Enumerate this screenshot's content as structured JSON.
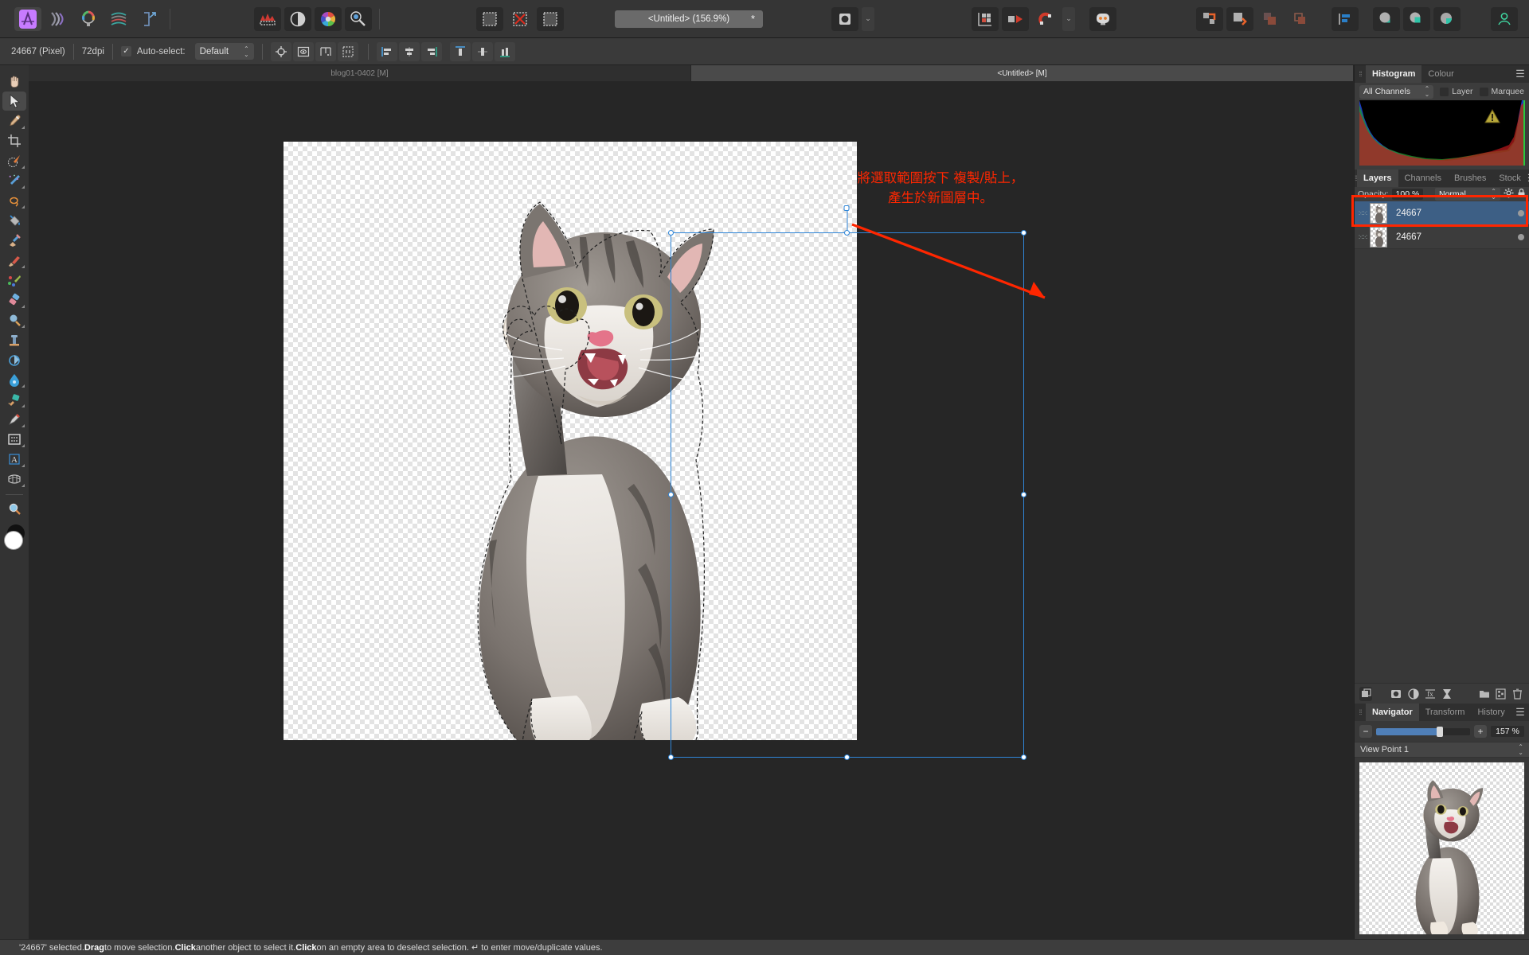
{
  "app": {
    "name": "Affinity Photo"
  },
  "toolbar": {
    "left_icons": [
      {
        "name": "app-persona-photo",
        "label": "Photo Persona"
      },
      {
        "name": "liquify-persona",
        "label": "Liquify Persona"
      },
      {
        "name": "develop-persona",
        "label": "Develop Persona"
      },
      {
        "name": "tone-mapping-persona",
        "label": "Tone Mapping Persona"
      },
      {
        "name": "export-persona",
        "label": "Export Persona"
      }
    ],
    "adjust_icons": [
      {
        "name": "histogram-adjust-icon",
        "label": "Adjustment"
      },
      {
        "name": "live-filter-icon",
        "label": "Live Filter"
      },
      {
        "name": "colour-wheel-icon",
        "label": "Colour"
      },
      {
        "name": "blemish-remove-icon",
        "label": "Blemish Removal"
      }
    ],
    "select_icons": [
      {
        "name": "select-pixel-icon",
        "label": "Select Pixel"
      },
      {
        "name": "deselect-icon",
        "label": "Deselect"
      },
      {
        "name": "refine-selection-icon",
        "label": "Refine Selection"
      }
    ],
    "document_title": "<Untitled> (156.9%)",
    "document_modified_mark": "*",
    "mask_icon_label": "Mask",
    "right_icons": [
      {
        "name": "snapping-grid-icon",
        "label": "Snapping Grid"
      },
      {
        "name": "snapping-candidates-icon",
        "label": "Snapping Candidates"
      },
      {
        "name": "magnet-snapping-icon",
        "label": "Snapping"
      },
      {
        "name": "assistant-icon",
        "label": "Assistant"
      },
      {
        "name": "arrange-move-icon",
        "label": "Arrange"
      },
      {
        "name": "arrange-forward-icon",
        "label": "Move Forward"
      },
      {
        "name": "arrange-back-icon",
        "label": "Move Back"
      },
      {
        "name": "arrange-backward-icon",
        "label": "Move Backward"
      },
      {
        "name": "studio-toggle-icon",
        "label": "Studio"
      },
      {
        "name": "boolean-add-icon",
        "label": "Add"
      },
      {
        "name": "boolean-subtract-icon",
        "label": "Subtract"
      },
      {
        "name": "boolean-intersect-icon",
        "label": "Intersect"
      },
      {
        "name": "account-icon",
        "label": "Account"
      }
    ]
  },
  "context_bar": {
    "doc_size": "24667 (Pixel)",
    "dpi": "72dpi",
    "autoselect_label": "Auto-select:",
    "autoselect_checked": true,
    "mode_value": "Default",
    "transform_buttons": [
      {
        "name": "show-transform-origin-icon",
        "label": "Transform origin"
      },
      {
        "name": "show-selection-bounds-icon",
        "label": "Show selection bounds"
      },
      {
        "name": "enable-transform-handles-icon",
        "label": "Transform handles"
      },
      {
        "name": "cycle-selection-box-icon",
        "label": "Cycle selection box"
      }
    ],
    "align_buttons": [
      {
        "name": "align-left-icon",
        "label": "Align left"
      },
      {
        "name": "align-center-horizontal-icon",
        "label": "Align centre"
      },
      {
        "name": "align-right-icon",
        "label": "Align right"
      },
      {
        "name": "align-top-icon",
        "label": "Align top"
      },
      {
        "name": "align-middle-vertical-icon",
        "label": "Align middle"
      },
      {
        "name": "align-bottom-icon",
        "label": "Align bottom"
      }
    ]
  },
  "tools": [
    {
      "name": "view-hand-tool",
      "label": "View Tool",
      "active": false,
      "glyph": "hand"
    },
    {
      "name": "move-tool",
      "label": "Move Tool",
      "active": true,
      "glyph": "cursor"
    },
    {
      "name": "colour-picker-tool",
      "label": "Colour Picker Tool",
      "active": false,
      "glyph": "picker"
    },
    {
      "name": "crop-tool",
      "label": "Crop Tool",
      "active": false,
      "glyph": "crop"
    },
    {
      "name": "selection-brush-tool",
      "label": "Selection Brush Tool",
      "active": false,
      "glyph": "selbrush"
    },
    {
      "name": "flood-select-tool",
      "label": "Flood Select Tool",
      "active": false,
      "glyph": "wand"
    },
    {
      "name": "freehand-selection-tool",
      "label": "Freehand Selection Tool",
      "active": false,
      "glyph": "lasso"
    },
    {
      "name": "paint-bucket-tool",
      "label": "Flood Fill Tool",
      "active": false,
      "glyph": "bucket"
    },
    {
      "name": "inpainting-brush-tool",
      "label": "Inpainting Brush Tool",
      "active": false,
      "glyph": "inpaint"
    },
    {
      "name": "paint-brush-tool",
      "label": "Paint Brush Tool",
      "active": false,
      "glyph": "brush"
    },
    {
      "name": "paint-mixer-brush-tool",
      "label": "Paint Mixer Brush Tool",
      "active": false,
      "glyph": "mixer"
    },
    {
      "name": "erase-brush-tool",
      "label": "Erase Brush Tool",
      "active": false,
      "glyph": "eraser"
    },
    {
      "name": "dodge-brush-tool",
      "label": "Dodge Brush Tool",
      "active": false,
      "glyph": "dodge"
    },
    {
      "name": "clone-brush-tool",
      "label": "Clone Brush Tool",
      "active": false,
      "glyph": "clone"
    },
    {
      "name": "smudge-brush-tool",
      "label": "Smudge Brush Tool",
      "active": false,
      "glyph": "smudge"
    },
    {
      "name": "blur-brush-tool",
      "label": "Blur Brush Tool",
      "active": false,
      "glyph": "blur"
    },
    {
      "name": "sponge-brush-tool",
      "label": "Sponge Brush Tool",
      "active": false,
      "glyph": "sponge"
    },
    {
      "name": "pen-tool",
      "label": "Pen Tool",
      "active": false,
      "glyph": "pen"
    },
    {
      "name": "rectangle-tool",
      "label": "Rectangle Tool",
      "active": false,
      "glyph": "rect"
    },
    {
      "name": "artistic-text-tool",
      "label": "Artistic Text Tool",
      "active": false,
      "glyph": "text"
    },
    {
      "name": "mesh-warp-tool",
      "label": "Mesh Warp Tool",
      "active": false,
      "glyph": "mesh"
    },
    {
      "name": "zoom-tool",
      "label": "Zoom Tool",
      "active": false,
      "glyph": "zoom"
    }
  ],
  "document_tabs": [
    {
      "label": "blog01-0402 [M]",
      "active": false
    },
    {
      "label": "<Untitled> [M]",
      "active": true
    }
  ],
  "annotation": {
    "text": "將選取範圍按下 複製/貼上，\n產生於新圖層中。",
    "colour": "#ff2600"
  },
  "histogram_panel": {
    "tabs": [
      {
        "label": "Histogram",
        "active": true
      },
      {
        "label": "Colour",
        "active": false
      }
    ],
    "channel_select": "All Channels",
    "checkboxes": [
      {
        "label": "Layer",
        "checked": false
      },
      {
        "label": "Marquee",
        "checked": false
      }
    ],
    "warning_icon": "clipping-warning-icon"
  },
  "layers_panel": {
    "tabs": [
      {
        "label": "Layers",
        "active": true
      },
      {
        "label": "Channels",
        "active": false
      },
      {
        "label": "Brushes",
        "active": false
      },
      {
        "label": "Stock",
        "active": false
      }
    ],
    "opacity_label": "Opacity:",
    "opacity_value": "100 %",
    "blend_mode": "Normal",
    "layers": [
      {
        "name": "24667",
        "selected": true
      },
      {
        "name": "24667",
        "selected": false
      }
    ],
    "tool_buttons": [
      {
        "name": "layer-duplicate-icon",
        "label": "Duplicate layer"
      },
      {
        "name": "mask-layer-icon",
        "label": "Mask layer"
      },
      {
        "name": "adjustment-layer-icon",
        "label": "Adjustment"
      },
      {
        "name": "live-filter-layer-icon",
        "label": "Live filter"
      },
      {
        "name": "layer-effects-icon",
        "label": "Layer effects"
      },
      {
        "name": "new-group-icon",
        "label": "New group"
      },
      {
        "name": "new-pixel-layer-icon",
        "label": "New pixel layer"
      },
      {
        "name": "delete-layer-icon",
        "label": "Delete layer"
      }
    ]
  },
  "navigator_panel": {
    "tabs": [
      {
        "label": "Navigator",
        "active": true
      },
      {
        "label": "Transform",
        "active": false
      },
      {
        "label": "History",
        "active": false
      }
    ],
    "zoom_minus": "−",
    "zoom_plus": "+",
    "zoom_value": "157 %",
    "view_point": "View Point 1"
  },
  "statusbar": {
    "prefix": "'24667' selected. ",
    "b1": "Drag",
    "t1": " to move selection. ",
    "b2": "Click",
    "t2": " another object to select it. ",
    "b3": "Click",
    "t3": " on an empty area to deselect selection. ↵ to enter move/duplicate values."
  }
}
